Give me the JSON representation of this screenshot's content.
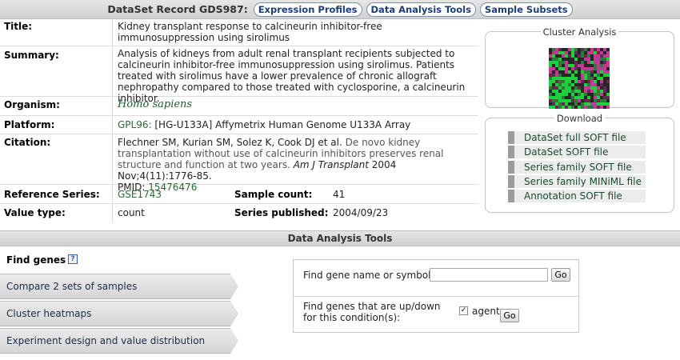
{
  "header": {
    "title": "DataSet Record GDS987:",
    "links": [
      "Expression Profiles",
      "Data Analysis Tools",
      "Sample Subsets"
    ]
  },
  "record": {
    "title_label": "Title:",
    "title_value": "Kidney transplant response to calcineurin inhibitor-free immunosuppression using sirolimus",
    "summary_label": "Summary:",
    "summary_value": "Analysis of kidneys from adult renal transplant recipients subjected to calcineurin inhibitor-free immunosuppression using sirolimus. Patients treated with sirolimus have a lower prevalence of chronic allograft nephropathy compared to those treated with cyclosporine, a calcineurin inhibitor.",
    "organism_label": "Organism:",
    "organism_value": "Homo sapiens",
    "platform_label": "Platform:",
    "platform_id": "GPL96:",
    "platform_value": "[HG-U133A] Affymetrix Human Genome U133A Array",
    "citation_label": "Citation:",
    "citation_authors": "Flechner SM, Kurian SM, Solez K, Cook DJ et al.",
    "citation_title": "De novo kidney transplantation without use of calcineurin inhibitors preserves renal structure and function at two years.",
    "citation_journal": "Am J Transplant",
    "citation_details": "2004 Nov;4(11):1776-85.",
    "pmid_label": "PMID:",
    "pmid_value": "15476476",
    "refseries_label": "Reference Series:",
    "refseries_value": "GSE1743",
    "samplecount_label": "Sample count:",
    "samplecount_value": "41",
    "valuetype_label": "Value type:",
    "valuetype_value": "count",
    "published_label": "Series published:",
    "published_value": "2004/09/23"
  },
  "cluster": {
    "title": "Cluster Analysis"
  },
  "download": {
    "title": "Download",
    "items": [
      "DataSet full SOFT file",
      "DataSet SOFT file",
      "Series family SOFT file",
      "Series family MINiML file",
      "Annotation SOFT file"
    ]
  },
  "tools": {
    "title": "Data Analysis Tools",
    "find_genes": "Find genes",
    "help": "?",
    "tabs": [
      "Compare 2 sets of samples",
      "Cluster heatmaps",
      "Experiment design and value distribution"
    ],
    "find_name_label": "Find gene name or symbol:",
    "go_label": "Go",
    "updown_label_1": "Find genes that are up/down",
    "updown_label_2": "for this condition(s):",
    "condition_label": "agent",
    "condition_checked": "✓"
  },
  "colors": {
    "link": "#1a4c2e",
    "pill": "#1c3f75",
    "heat_green": "#1fcf3c",
    "heat_magenta": "#c23a95"
  }
}
